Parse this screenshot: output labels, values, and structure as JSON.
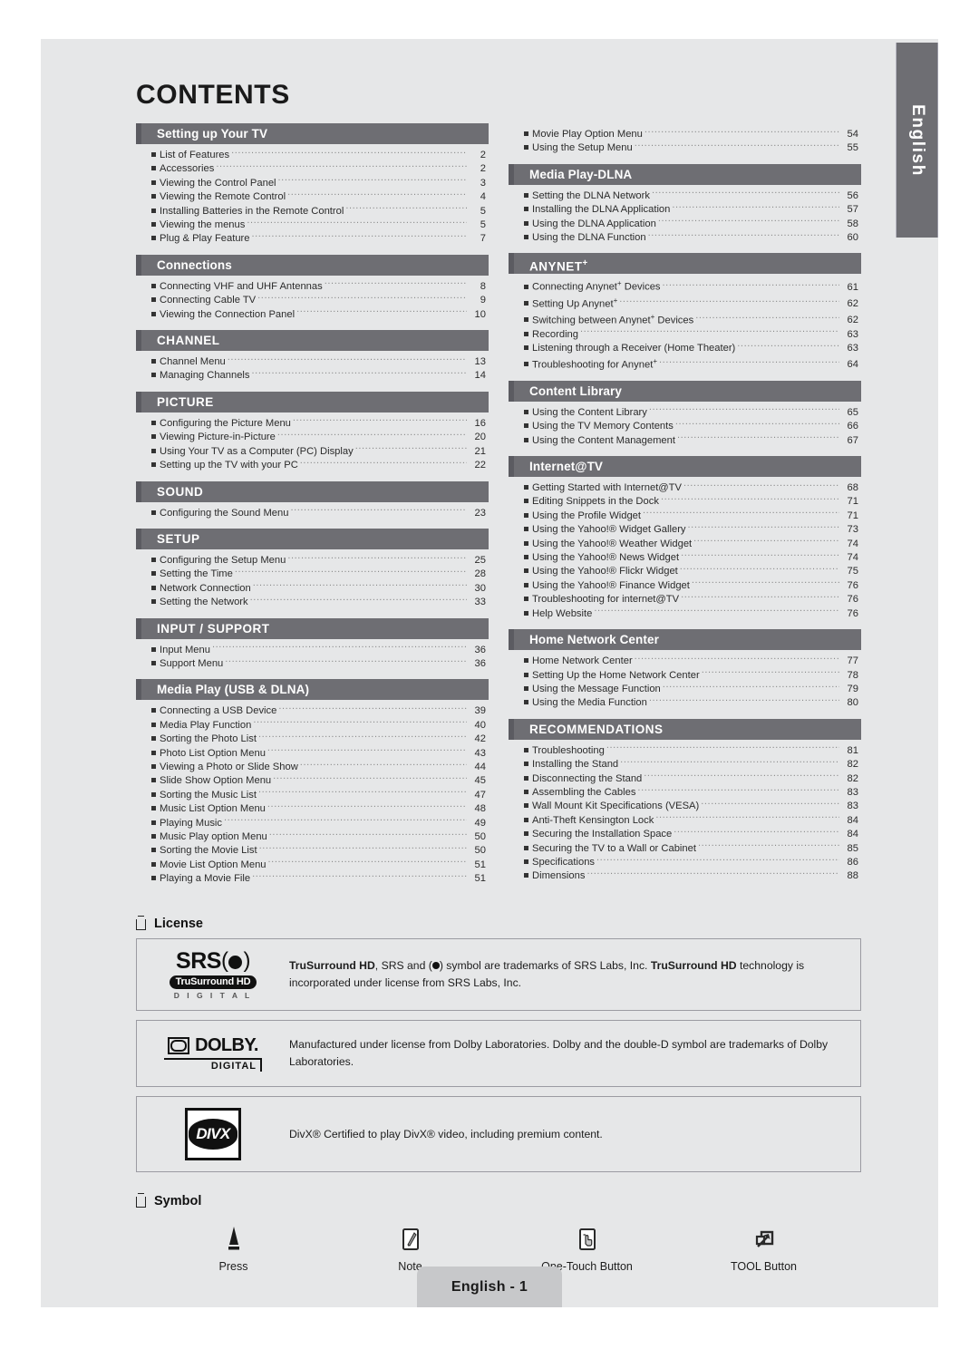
{
  "page": {
    "title": "CONTENTS",
    "lang_tab": "English",
    "footer": "English - 1"
  },
  "toc": {
    "left": [
      {
        "heading": "Setting up Your TV",
        "style": "mixed",
        "items": [
          {
            "label": "List of Features",
            "page": "2"
          },
          {
            "label": "Accessories",
            "page": "2"
          },
          {
            "label": "Viewing the Control Panel",
            "page": "3"
          },
          {
            "label": "Viewing the Remote Control",
            "page": "4"
          },
          {
            "label": "Installing Batteries in the Remote Control",
            "page": "5"
          },
          {
            "label": "Viewing the menus",
            "page": "5"
          },
          {
            "label": "Plug & Play Feature",
            "page": "7"
          }
        ]
      },
      {
        "heading": "Connections",
        "style": "mixed",
        "items": [
          {
            "label": "Connecting VHF and UHF Antennas",
            "page": "8"
          },
          {
            "label": "Connecting Cable TV",
            "page": "9"
          },
          {
            "label": "Viewing the Connection Panel",
            "page": "10"
          }
        ]
      },
      {
        "heading": "CHANNEL",
        "style": "caps",
        "items": [
          {
            "label": "Channel Menu",
            "page": "13"
          },
          {
            "label": "Managing Channels",
            "page": "14"
          }
        ]
      },
      {
        "heading": "PICTURE",
        "style": "caps",
        "items": [
          {
            "label": "Configuring the Picture Menu",
            "page": "16"
          },
          {
            "label": "Viewing Picture-in-Picture",
            "page": "20"
          },
          {
            "label": "Using Your TV as a Computer (PC) Display",
            "page": "21"
          },
          {
            "label": "Setting up the TV with your PC",
            "page": "22"
          }
        ]
      },
      {
        "heading": "SOUND",
        "style": "caps",
        "items": [
          {
            "label": "Configuring the Sound Menu",
            "page": "23"
          }
        ]
      },
      {
        "heading": "SETUP",
        "style": "caps",
        "items": [
          {
            "label": "Configuring the Setup Menu",
            "page": "25"
          },
          {
            "label": "Setting the Time",
            "page": "28"
          },
          {
            "label": "Network Connection",
            "page": "30"
          },
          {
            "label": "Setting the Network",
            "page": "33"
          }
        ]
      },
      {
        "heading": "INPUT / SUPPORT",
        "style": "caps",
        "items": [
          {
            "label": "Input Menu",
            "page": "36"
          },
          {
            "label": "Support Menu",
            "page": "36"
          }
        ]
      },
      {
        "heading": "Media Play (USB & DLNA)",
        "style": "mixed",
        "items": [
          {
            "label": "Connecting a USB Device",
            "page": "39"
          },
          {
            "label": "Media Play Function",
            "page": "40"
          },
          {
            "label": "Sorting the Photo List",
            "page": "42"
          },
          {
            "label": "Photo List Option Menu",
            "page": "43"
          },
          {
            "label": "Viewing a Photo or Slide Show",
            "page": "44"
          },
          {
            "label": "Slide Show Option Menu",
            "page": "45"
          },
          {
            "label": "Sorting the Music List",
            "page": "47"
          },
          {
            "label": "Music List Option Menu",
            "page": "48"
          },
          {
            "label": "Playing Music",
            "page": "49"
          },
          {
            "label": "Music Play option Menu",
            "page": "50"
          },
          {
            "label": "Sorting the Movie List",
            "page": "50"
          },
          {
            "label": "Movie List Option Menu",
            "page": "51"
          },
          {
            "label": "Playing a Movie File",
            "page": "51"
          }
        ]
      }
    ],
    "right": [
      {
        "heading": null,
        "style": "mixed",
        "items": [
          {
            "label": "Movie Play Option Menu",
            "page": "54"
          },
          {
            "label": "Using the Setup Menu",
            "page": "55"
          }
        ]
      },
      {
        "heading": "Media Play-DLNA",
        "style": "mixed",
        "items": [
          {
            "label": "Setting the DLNA Network",
            "page": "56"
          },
          {
            "label": "Installing the DLNA Application",
            "page": "57"
          },
          {
            "label": "Using the DLNA Application",
            "page": "58"
          },
          {
            "label": "Using the DLNA Function",
            "page": "60"
          }
        ]
      },
      {
        "heading": "ANYNET+",
        "style": "caps",
        "items": [
          {
            "label": "Connecting Anynet+ Devices",
            "page": "61"
          },
          {
            "label": "Setting Up Anynet+",
            "page": "62"
          },
          {
            "label": "Switching between Anynet+ Devices",
            "page": "62"
          },
          {
            "label": "Recording",
            "page": "63"
          },
          {
            "label": "Listening through a Receiver (Home Theater)",
            "page": "63"
          },
          {
            "label": "Troubleshooting for Anynet+",
            "page": "64"
          }
        ]
      },
      {
        "heading": "Content Library",
        "style": "mixed",
        "items": [
          {
            "label": "Using the Content Library",
            "page": "65"
          },
          {
            "label": "Using the TV Memory Contents",
            "page": "66"
          },
          {
            "label": "Using the Content Management",
            "page": "67"
          }
        ]
      },
      {
        "heading": "Internet@TV",
        "style": "mixed",
        "items": [
          {
            "label": "Getting Started with Internet@TV",
            "page": "68"
          },
          {
            "label": "Editing Snippets in the Dock",
            "page": "71"
          },
          {
            "label": "Using the Profile Widget",
            "page": "71"
          },
          {
            "label": "Using the Yahoo!® Widget Gallery",
            "page": "73"
          },
          {
            "label": "Using the Yahoo!® Weather Widget",
            "page": "74"
          },
          {
            "label": "Using the Yahoo!® News Widget",
            "page": "74"
          },
          {
            "label": "Using the Yahoo!® Flickr Widget",
            "page": "75"
          },
          {
            "label": "Using the Yahoo!® Finance Widget",
            "page": "76"
          },
          {
            "label": "Troubleshooting for internet@TV",
            "page": "76"
          },
          {
            "label": "Help Website",
            "page": "76"
          }
        ]
      },
      {
        "heading": "Home Network Center",
        "style": "mixed",
        "items": [
          {
            "label": "Home Network Center",
            "page": "77"
          },
          {
            "label": "Setting Up the Home Network Center",
            "page": "78"
          },
          {
            "label": "Using the Message Function",
            "page": "79"
          },
          {
            "label": "Using the Media Function",
            "page": "80"
          }
        ]
      },
      {
        "heading": "RECOMMENDATIONS",
        "style": "caps",
        "items": [
          {
            "label": "Troubleshooting",
            "page": "81"
          },
          {
            "label": "Installing the Stand",
            "page": "82"
          },
          {
            "label": "Disconnecting the Stand",
            "page": "82"
          },
          {
            "label": "Assembling the Cables",
            "page": "83"
          },
          {
            "label": "Wall Mount Kit Specifications (VESA)",
            "page": "83"
          },
          {
            "label": "Anti-Theft Kensington Lock",
            "page": "84"
          },
          {
            "label": "Securing the Installation Space",
            "page": "84"
          },
          {
            "label": "Securing the TV to a Wall or Cabinet",
            "page": "85"
          },
          {
            "label": "Specifications",
            "page": "86"
          },
          {
            "label": "Dimensions",
            "page": "88"
          }
        ]
      }
    ]
  },
  "license": {
    "heading": "License",
    "entries": [
      {
        "logo": "srs-trusurround-hd-digital-logo",
        "logo_text": {
          "brand": "SRS",
          "badge": "TruSurround HD",
          "sub": "D I G I T A L"
        },
        "text_bold_1": "TruSurround HD",
        "text_rest_1": ", SRS and ",
        "text_rest_2": " symbol are trademarks of SRS Labs, Inc. ",
        "text_bold_2": "TruSurround HD",
        "text_rest_3": " technology is incorporated under license from SRS Labs, Inc."
      },
      {
        "logo": "dolby-digital-logo",
        "logo_text": {
          "word": "DOLBY.",
          "sub": "DIGITAL"
        },
        "text": "Manufactured under license from Dolby Laboratories. Dolby and the double-D symbol are trademarks of Dolby Laboratories."
      },
      {
        "logo": "divx-logo",
        "logo_text": {
          "word": "DIVX"
        },
        "text": "DivX® Certified to play DivX® video, including premium content."
      }
    ]
  },
  "symbol": {
    "heading": "Symbol",
    "items": [
      {
        "icon": "press-arrow-icon",
        "label": "Press"
      },
      {
        "icon": "note-pencil-icon",
        "label": "Note"
      },
      {
        "icon": "one-touch-hand-icon",
        "label": "One-Touch Button"
      },
      {
        "icon": "tool-button-icon",
        "label": "TOOL Button"
      }
    ]
  },
  "colors": {
    "page_bg": "#e6e7e8",
    "section_header": "#6e6e73",
    "section_header_accent": "#5b5b61",
    "footer_tab": "#c7c8ca"
  }
}
